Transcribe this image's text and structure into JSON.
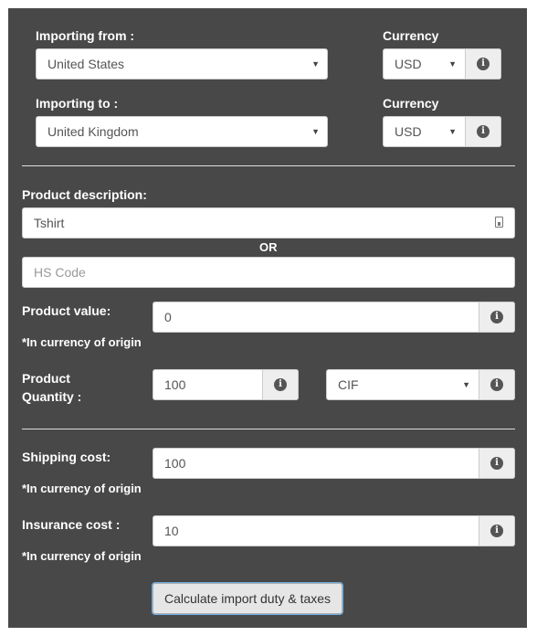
{
  "import_from": {
    "label": "Importing from :",
    "country": "United States",
    "currency_label": "Currency",
    "currency": "USD"
  },
  "import_to": {
    "label": "Importing to :",
    "country": "United Kingdom",
    "currency_label": "Currency",
    "currency": "USD"
  },
  "product": {
    "description_label": "Product description:",
    "description_value": "Tshirt",
    "or_text": "OR",
    "hs_code_placeholder": "HS Code",
    "value_label": "Product value:",
    "value": "0",
    "currency_note": "*In currency of origin",
    "quantity_label_line1": "Product",
    "quantity_label_line2": "Quantity :",
    "quantity": "100",
    "incoterm": "CIF"
  },
  "shipping": {
    "label": "Shipping cost:",
    "value": "100",
    "note": "*In currency of origin"
  },
  "insurance": {
    "label": "Insurance cost :",
    "value": "10",
    "note": "*In currency of origin"
  },
  "actions": {
    "calculate_label": "Calculate import duty & taxes"
  },
  "icons": {
    "info": "info-circle-icon",
    "dropdown": "caret-down-icon",
    "document": "document-icon"
  }
}
